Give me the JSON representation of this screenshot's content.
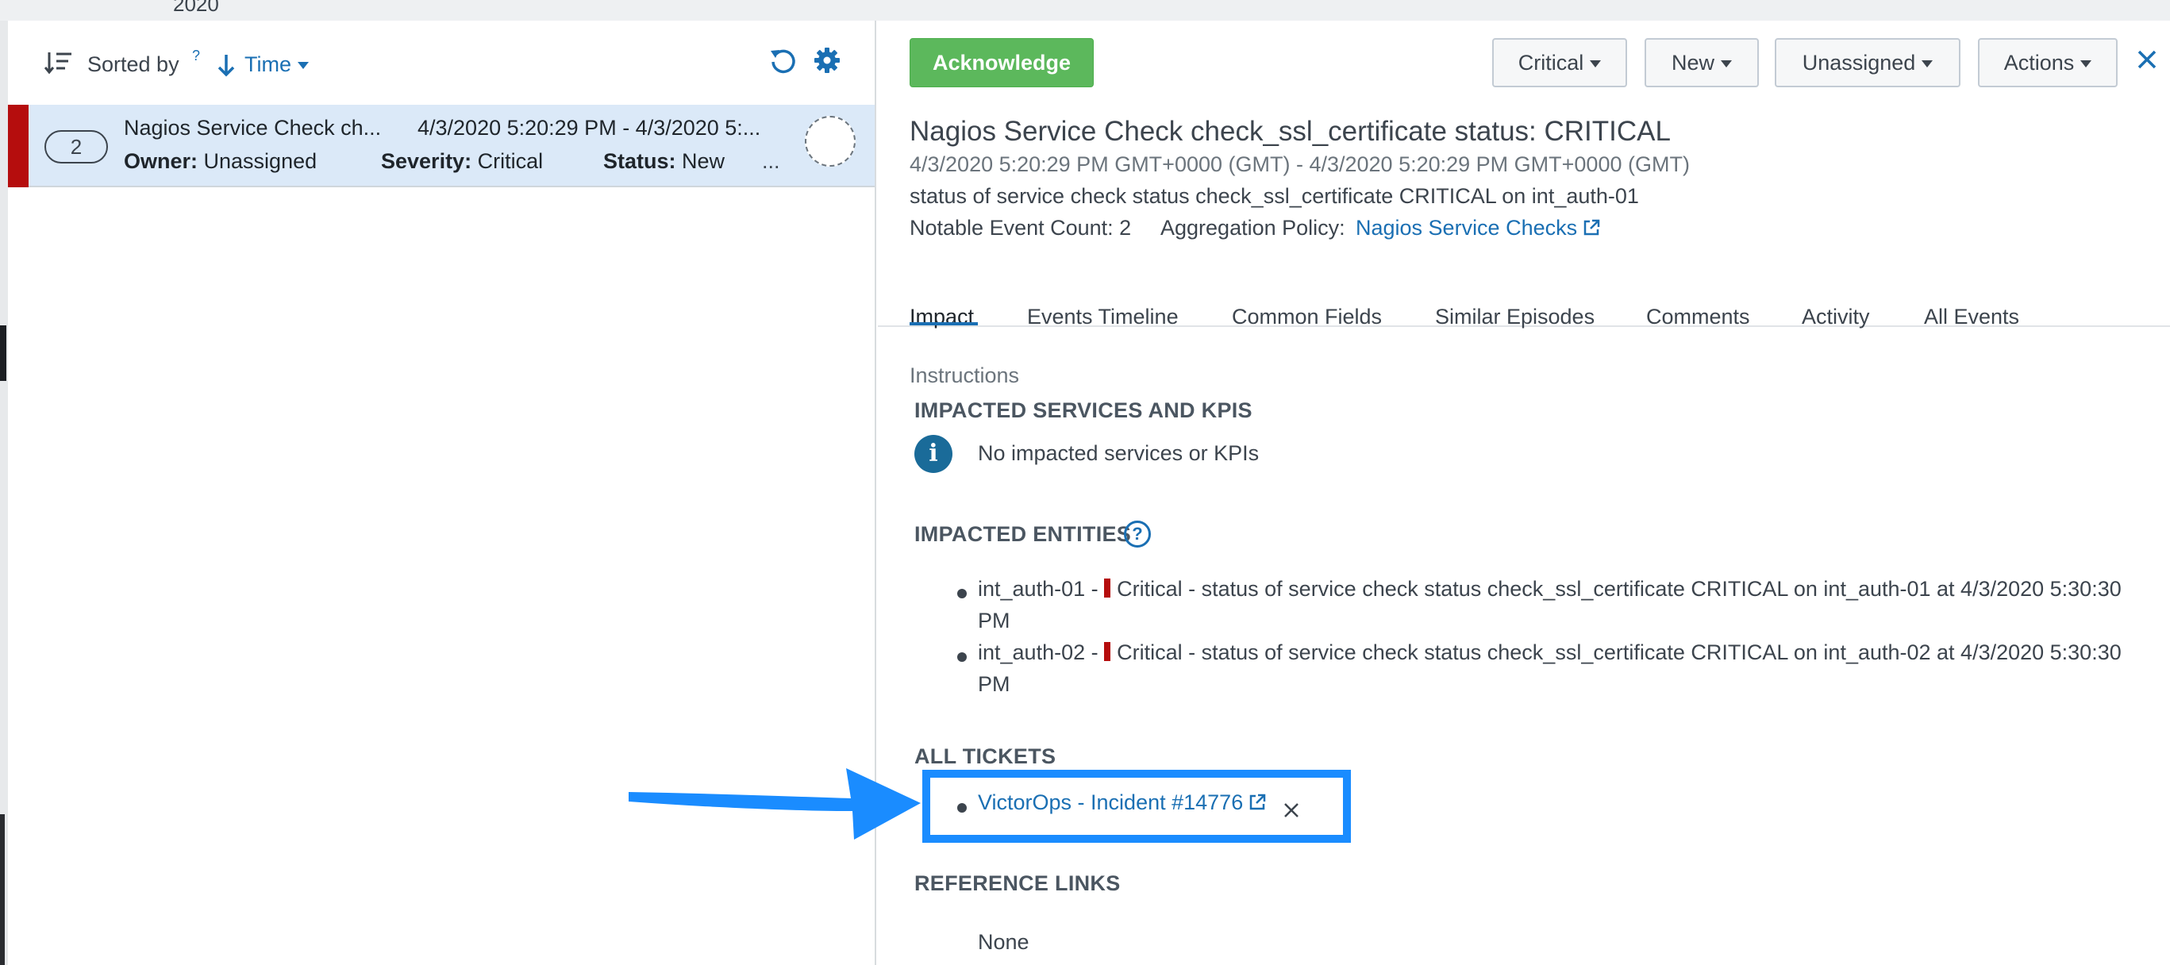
{
  "top_strip": {
    "text": "2020"
  },
  "left_panel": {
    "sort_label": "Sorted by",
    "sort_help": "?",
    "sort_field": "Time",
    "episode": {
      "count": "2",
      "title": "Nagios Service Check ch...",
      "time_range": "4/3/2020 5:20:29 PM - 4/3/2020 5:...",
      "owner_label": "Owner:",
      "owner_value": "Unassigned",
      "severity_label": "Severity:",
      "severity_value": "Critical",
      "status_label": "Status:",
      "status_value": "New",
      "more": "...",
      "severity_color": "#b50d0d"
    }
  },
  "toolbar": {
    "acknowledge": "Acknowledge",
    "severity_dropdown": "Critical",
    "status_dropdown": "New",
    "owner_dropdown": "Unassigned",
    "actions_dropdown": "Actions"
  },
  "detail": {
    "title": "Nagios Service Check check_ssl_certificate status: CRITICAL",
    "time_range": "4/3/2020 5:20:29 PM GMT+0000 (GMT) - 4/3/2020 5:20:29 PM GMT+0000 (GMT)",
    "description": "status of service check status check_ssl_certificate CRITICAL on int_auth-01",
    "event_count": "Notable Event Count: 2",
    "policy_label": "Aggregation Policy:",
    "policy_link": "Nagios Service Checks"
  },
  "tabs": [
    "Impact",
    "Events Timeline",
    "Common Fields",
    "Similar Episodes",
    "Comments",
    "Activity",
    "All Events"
  ],
  "impact": {
    "instructions": "Instructions",
    "services_heading": "IMPACTED SERVICES AND KPIS",
    "no_services": "No impacted services or KPIs",
    "entities_heading": "IMPACTED ENTITIES",
    "entities_help": "?",
    "entities": [
      {
        "name": "int_auth-01 -",
        "detail": "Critical - status of service check status check_ssl_certificate CRITICAL on int_auth-01 at 4/3/2020 5:30:30",
        "tail": "PM"
      },
      {
        "name": "int_auth-02 -",
        "detail": "Critical - status of service check status check_ssl_certificate CRITICAL on int_auth-02 at 4/3/2020 5:30:30",
        "tail": "PM"
      }
    ],
    "tickets_heading": "ALL TICKETS",
    "ticket_link": "VictorOps - Incident #14776",
    "reference_heading": "REFERENCE LINKS",
    "reference_none": "None"
  },
  "colors": {
    "accent": "#1a6fb3",
    "acknowledge": "#5cb85c",
    "critical": "#b50d0d",
    "highlight": "#1a8cff",
    "selected_row": "#dbe9f8"
  }
}
